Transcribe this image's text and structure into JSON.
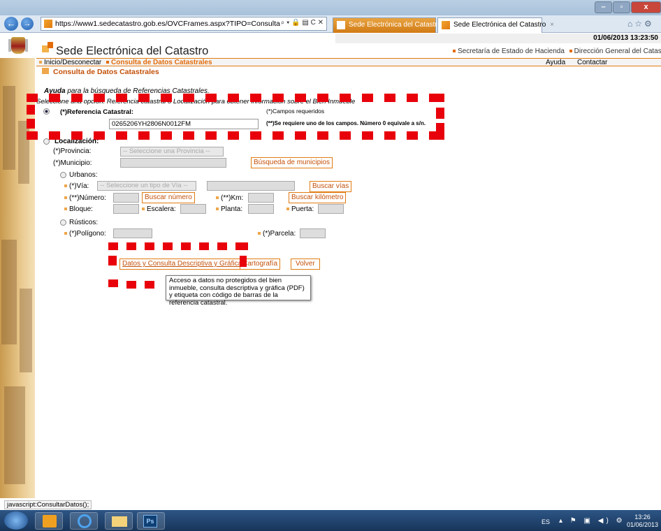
{
  "browser": {
    "url": "https://www1.sedecatastro.gob.es/OVCFrames.aspx?TIPO=Consulta",
    "addr_controls": "⌕ ▾ 🔒 ▤ C ✕",
    "tabs": [
      {
        "label": "Sede Electrónica del Catastro"
      },
      {
        "label": "Sede Electrónica del Catastro",
        "close": "×"
      }
    ]
  },
  "site": {
    "date": "01/06/2013 13:23:50",
    "title": "Sede Electrónica del Catastro",
    "links": [
      "Secretaría de Estado de Hacienda",
      "Dirección General del Catastro"
    ],
    "breadcrumb": {
      "home": "Inicio/Desconectar",
      "current": "Consulta de Datos Catastrales"
    },
    "help": "Ayuda",
    "contact": "Contactar"
  },
  "form": {
    "section_title": "Consulta de Datos Catastrales",
    "help_bold": "Ayuda",
    "help_rest": " para la búsqueda de Referencias Catastrales.",
    "instructions": "Seleccione una opción: Referencia catastral o Localización para obtener información sobre el Bien Inmueble",
    "ref_label": "(*)Referencia Catastral:",
    "ref_value": "0265206YH2806N0012FM",
    "required_note": "(*)Campos requeridos",
    "one_required_note": "(**)Se requiere uno de los campos. Número 0 equivale a s/n.",
    "localizacion": "Localización:",
    "provincia_label": "(*)Provincia:",
    "provincia_placeholder": "-- Seleccione una Provincia --",
    "municipio_label": "(*)Municipio:",
    "buscar_municipios": "Búsqueda de municipios",
    "urbanos": "Urbanos:",
    "via_label": "(*)Vía:",
    "via_placeholder": "-- Seleccione un tipo de Vía --",
    "buscar_vias": "Buscar vías",
    "numero_label": "(**)Número:",
    "buscar_numero": "Buscar número",
    "km_label": "(**)Km:",
    "buscar_km": "Buscar kilómetro",
    "bloque_label": "Bloque:",
    "escalera_label": "Escalera:",
    "planta_label": "Planta:",
    "puerta_label": "Puerta:",
    "rusticos": "Rústicos:",
    "poligono_label": "(*)Polígono:",
    "parcela_label": "(*)Parcela:",
    "btn_datos": "Datos y Consulta Descriptiva y Gráfica",
    "btn_carto": "Cartografía",
    "btn_volver": "Volver",
    "tooltip": "Acceso a datos no protegidos del bien inmueble, consulta descriptiva y gráfica (PDF) y etiqueta con código de barras de la referencia catastral."
  },
  "status": "javascript:ConsultarDatos();",
  "taskbar": {
    "lang": "ES",
    "time": "13:26",
    "date": "01/06/2013",
    "tray_icons": "▴ ⚑ ▣ ◀) ⚙"
  },
  "colors": {
    "accent": "#e36c0a",
    "annotation": "#e8000b"
  }
}
